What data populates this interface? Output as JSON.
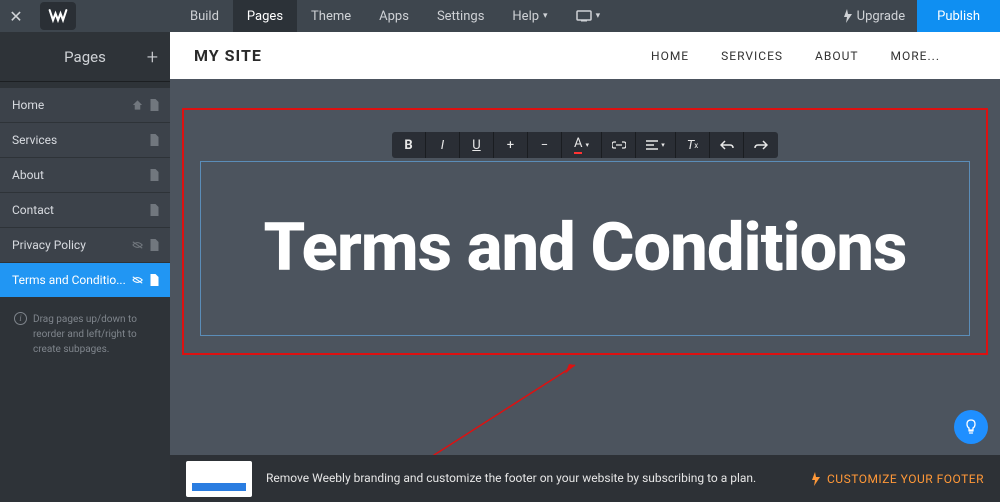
{
  "topbar": {
    "menu": [
      "Build",
      "Pages",
      "Theme",
      "Apps",
      "Settings",
      "Help"
    ],
    "active": 1,
    "upgrade": "Upgrade",
    "publish": "Publish"
  },
  "sidebar": {
    "title": "Pages",
    "items": [
      {
        "label": "Home",
        "hidden": false,
        "home": true
      },
      {
        "label": "Services",
        "hidden": false
      },
      {
        "label": "About",
        "hidden": false
      },
      {
        "label": "Contact",
        "hidden": false
      },
      {
        "label": "Privacy Policy",
        "hidden": true
      },
      {
        "label": "Terms and Conditio...",
        "hidden": true,
        "active": true
      }
    ],
    "hint": "Drag pages up/down to reorder and left/right to create subpages."
  },
  "site": {
    "title": "MY SITE",
    "nav": [
      "HOME",
      "SERVICES",
      "ABOUT",
      "MORE..."
    ]
  },
  "editor": {
    "heading": "Terms and Conditions"
  },
  "footer": {
    "text": "Remove Weebly branding and customize the footer on your website by subscribing to a plan.",
    "cta": "CUSTOMIZE YOUR FOOTER"
  }
}
